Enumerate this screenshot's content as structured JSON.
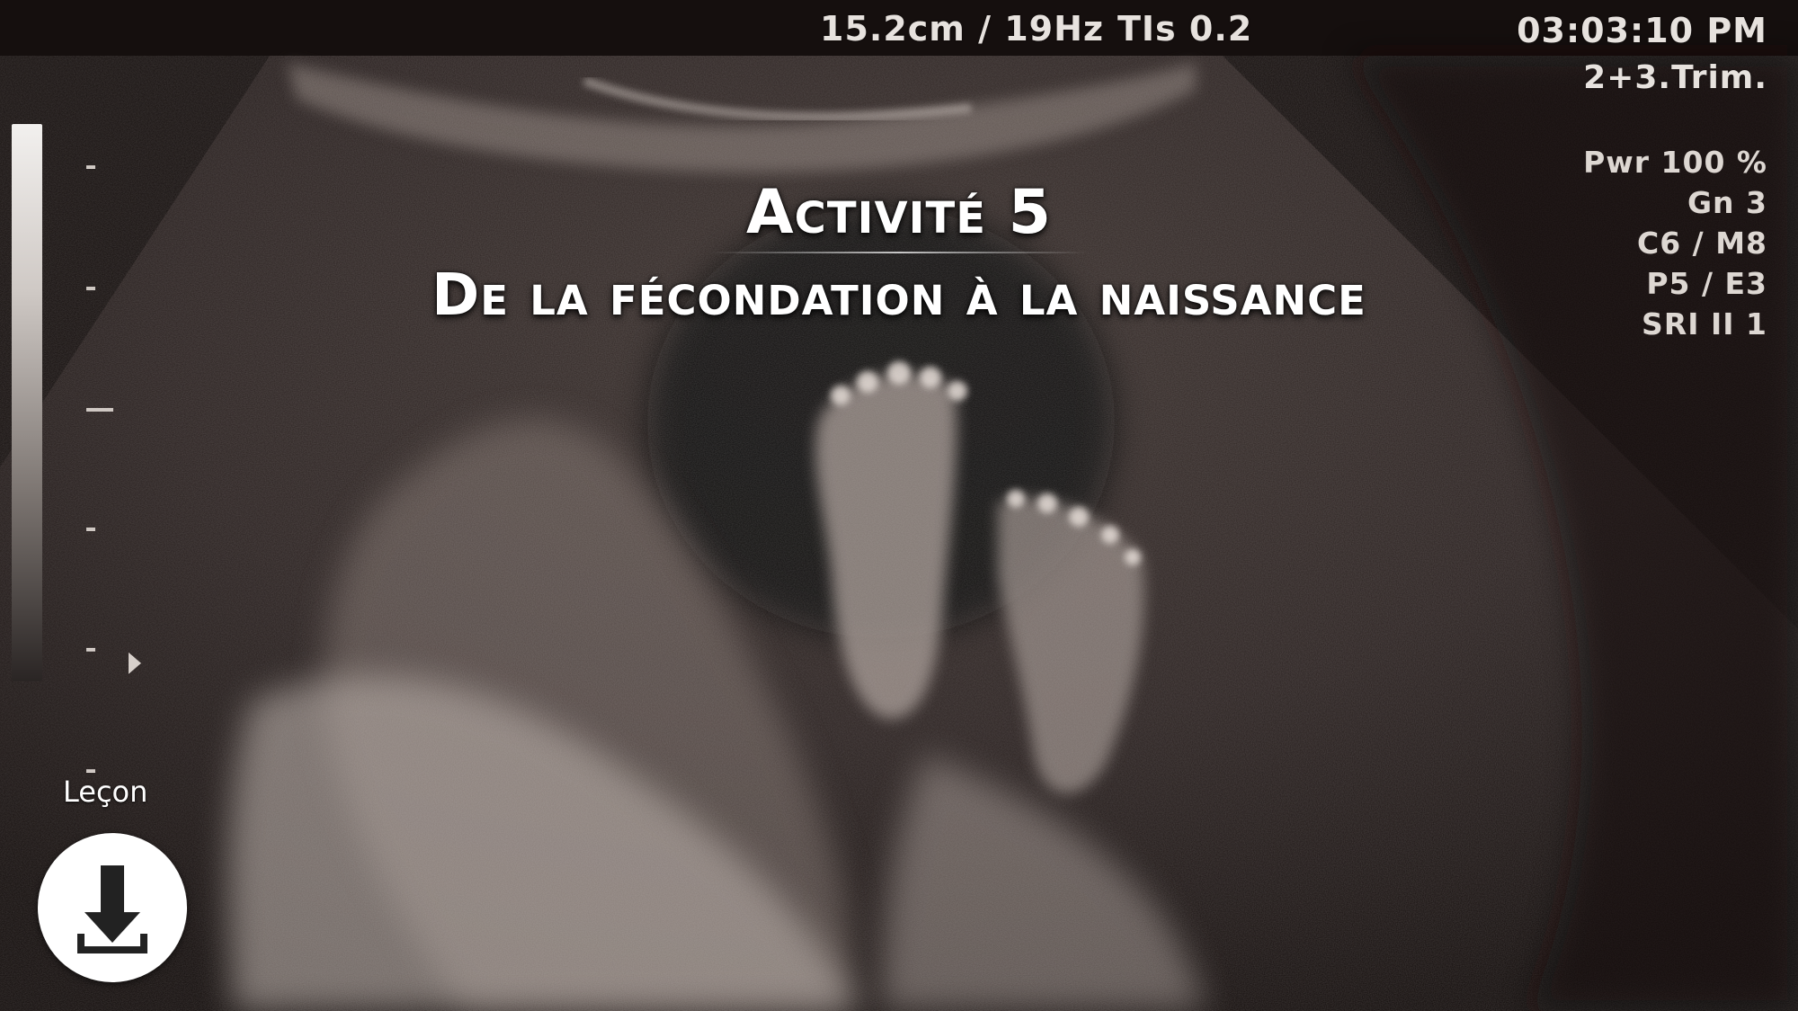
{
  "hud": {
    "depth_freq": "15.2cm / 19Hz",
    "tis": "TIs  0.2",
    "time": "03:03:10 PM",
    "trimester": "2+3.Trim.",
    "settings": [
      "Pwr  100 %",
      "Gn    3",
      "C6 / M8",
      "P5 / E3",
      "SRI II 1"
    ]
  },
  "title": {
    "line1": "Activité 5",
    "line2": "De la fécondation à la naissance"
  },
  "lesson": {
    "label": "Leçon",
    "icon": "download-icon"
  },
  "colors": {
    "background": "#1b1412",
    "text": "#ffffff",
    "button": "#ffffff",
    "icon": "#222222"
  }
}
